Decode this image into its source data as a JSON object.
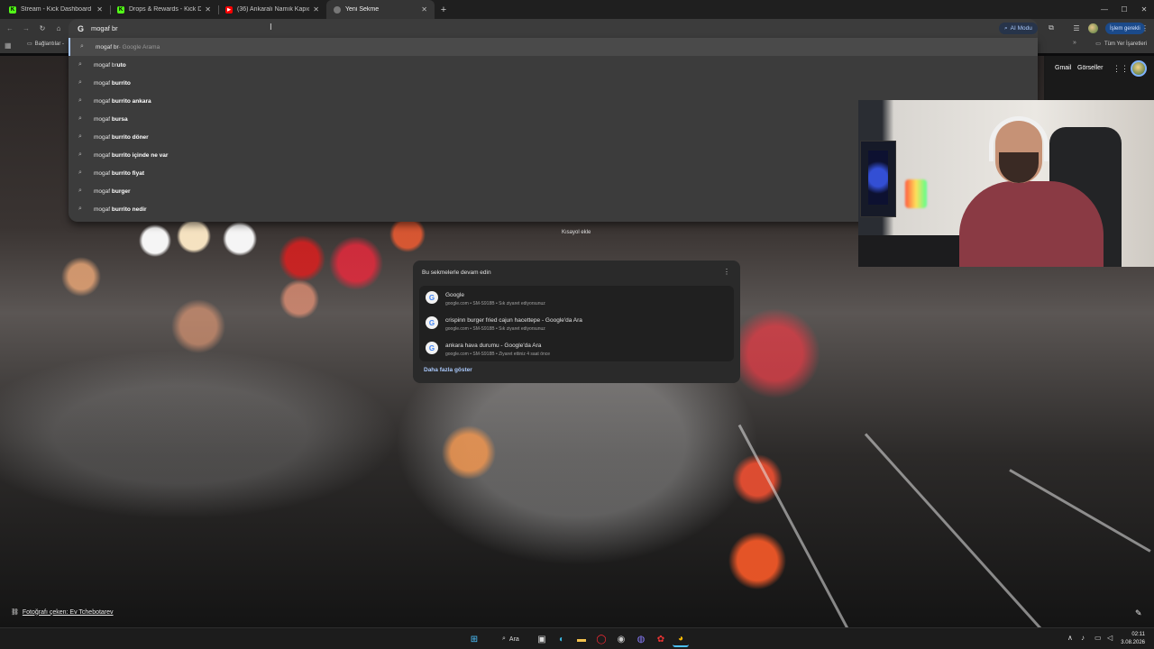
{
  "tabs": [
    {
      "label": "Stream - Kick Dashboard",
      "icon": "kick-icon",
      "active": false
    },
    {
      "label": "Drops & Rewards - Kick Dashb...",
      "icon": "kick-icon",
      "active": false
    },
    {
      "label": "(36) Ankaralı Namık Kapıcı İzze...",
      "icon": "youtube-icon",
      "active": false
    },
    {
      "label": "Yeni Sekme",
      "icon": "globe-icon",
      "active": true
    }
  ],
  "omnibox": {
    "value": "mogaf br",
    "engine_icon": "G"
  },
  "toolbar": {
    "ai_mode": "AI Modu",
    "profile_action": "İşlem gerekli"
  },
  "bookmarks": {
    "first": "Bağlantılar -",
    "all": "Tüm Yer İşaretleri"
  },
  "suggestions": [
    {
      "typed": "mogaf br",
      "rest": "",
      "hint": " - Google Arama"
    },
    {
      "typed": "mogaf br",
      "rest": "uto",
      "hint": ""
    },
    {
      "typed": "mogaf ",
      "rest": "burrito",
      "hint": ""
    },
    {
      "typed": "mogaf ",
      "rest": "burrito ankara",
      "hint": ""
    },
    {
      "typed": "mogaf ",
      "rest": "bursa",
      "hint": ""
    },
    {
      "typed": "mogaf ",
      "rest": "burrito döner",
      "hint": ""
    },
    {
      "typed": "mogaf ",
      "rest": "burrito içinde ne var",
      "hint": ""
    },
    {
      "typed": "mogaf ",
      "rest": "burrito fiyat",
      "hint": ""
    },
    {
      "typed": "mogaf ",
      "rest": "burger",
      "hint": ""
    },
    {
      "typed": "mogaf ",
      "rest": "burrito nedir",
      "hint": ""
    }
  ],
  "ntp": {
    "gmail": "Gmail",
    "images": "Görseller",
    "shortcut": "Kısayol ekle"
  },
  "continue_card": {
    "title": "Bu sekmelerle devam edin",
    "items": [
      {
        "title": "Google",
        "meta": "google.com • SM-S918B • Sık ziyaret ediyorsunuz"
      },
      {
        "title": "crispinn burger fried cajun hacettepe - Google'da Ara",
        "meta": "google.com • SM-S918B • Sık ziyaret ediyorsunuz"
      },
      {
        "title": "ankara hava durumu - Google'da Ara",
        "meta": "google.com • SM-S918B • Ziyaret ettiniz 4 saat önce"
      }
    ],
    "more": "Daha fazla göster"
  },
  "credit": {
    "text": "Fotoğrafı çeken: Ev Tchebotarev"
  },
  "taskbar": {
    "search": "Ara"
  },
  "clock": {
    "time": "02:11",
    "date": "3.08.2026"
  },
  "colors": {
    "accent": "#a8c7fa",
    "tab_bg": "#1f1f1f",
    "toolbar_bg": "#353535",
    "omnibox_bg": "#3c3c3c"
  }
}
